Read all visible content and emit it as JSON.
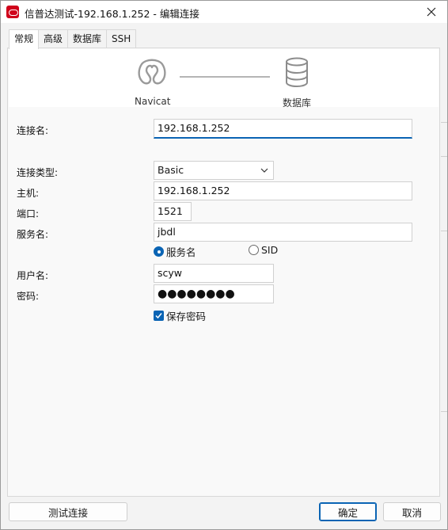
{
  "window": {
    "title": "信普达测试-192.168.1.252 - 编辑连接"
  },
  "tabs": [
    {
      "label": "常规",
      "active": true
    },
    {
      "label": "高级",
      "active": false
    },
    {
      "label": "数据库",
      "active": false
    },
    {
      "label": "SSH",
      "active": false
    }
  ],
  "banner": {
    "left_label": "Navicat",
    "right_label": "数据库",
    "left_icon": "navicat-logo-icon",
    "right_icon": "database-icon"
  },
  "form": {
    "connection_name_label": "连接名:",
    "connection_name_value": "192.168.1.252",
    "connection_type_label": "连接类型:",
    "connection_type_value": "Basic",
    "host_label": "主机:",
    "host_value": "192.168.1.252",
    "port_label": "端口:",
    "port_value": "1521",
    "service_name_label": "服务名:",
    "service_name_value": "jbdl",
    "radio_service_name": "服务名",
    "radio_sid": "SID",
    "username_label": "用户名:",
    "username_value": "scyw",
    "password_label": "密码:",
    "password_value": "●●●●●●●●",
    "save_password_label": "保存密码"
  },
  "footer": {
    "test_button": "测试连接",
    "ok_button": "确定",
    "cancel_button": "取消"
  },
  "colors": {
    "accent": "#0a64b4",
    "app_icon": "#d0021b"
  }
}
